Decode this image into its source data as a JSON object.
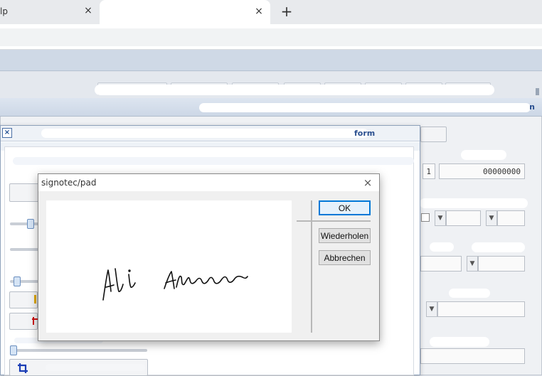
{
  "browser": {
    "tab_inactive_title": "lp",
    "tab_inactive_close": "×",
    "tab_active_title": "",
    "tab_active_close": "×",
    "new_tab": "+"
  },
  "app": {
    "form": {
      "title_link": "n",
      "number_field": "1",
      "id_field": "00000000"
    },
    "middle_dialog": {
      "close": "×",
      "title_suffix": "form"
    }
  },
  "pad_dialog": {
    "title": "signotec/pad",
    "close": "×",
    "buttons": {
      "ok": "OK",
      "retry": "Wiederholen",
      "cancel": "Abbrechen"
    },
    "signature_name": "Ali Abbas"
  },
  "colors": {
    "accent": "#0078d7",
    "link": "#2a4f8f",
    "crop_icon": "#1a3db5",
    "red_icon": "#cc1111"
  }
}
